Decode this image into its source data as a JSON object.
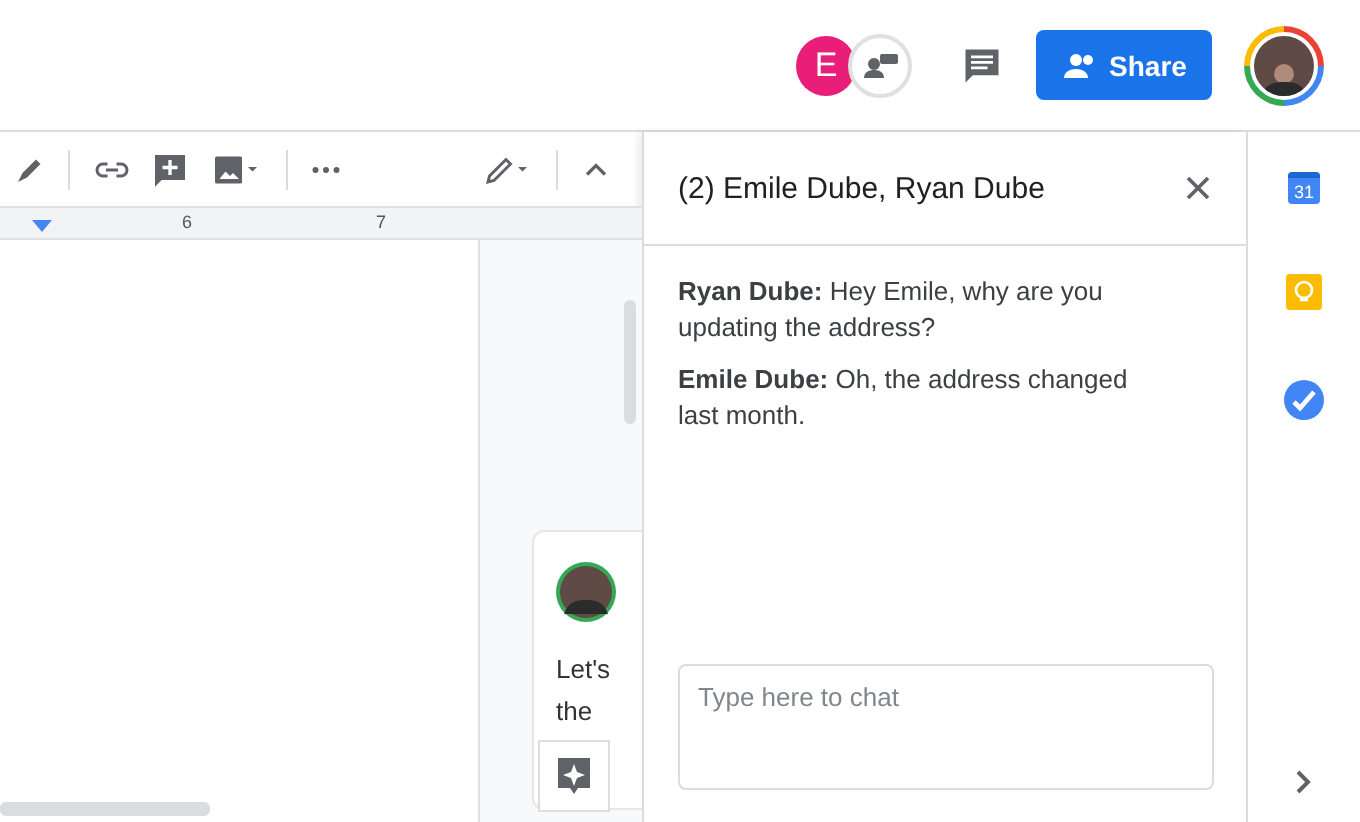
{
  "top_bar": {
    "collaborator_initial": "E",
    "share_button": "Share"
  },
  "ruler": {
    "numbers": [
      "6",
      "7"
    ]
  },
  "comment_card": {
    "lines": [
      "Let's",
      "the"
    ]
  },
  "chat": {
    "title": "(2) Emile Dube, Ryan Dube",
    "messages": [
      "**Ryan Dube:** Hey Emile, why are you updating the address?",
      "**Emile Dube:** Oh, the address changed last month."
    ],
    "input": {
      "placeholder": "Type here to chat"
    }
  },
  "side_panel": {
    "calendar_day": "31"
  }
}
